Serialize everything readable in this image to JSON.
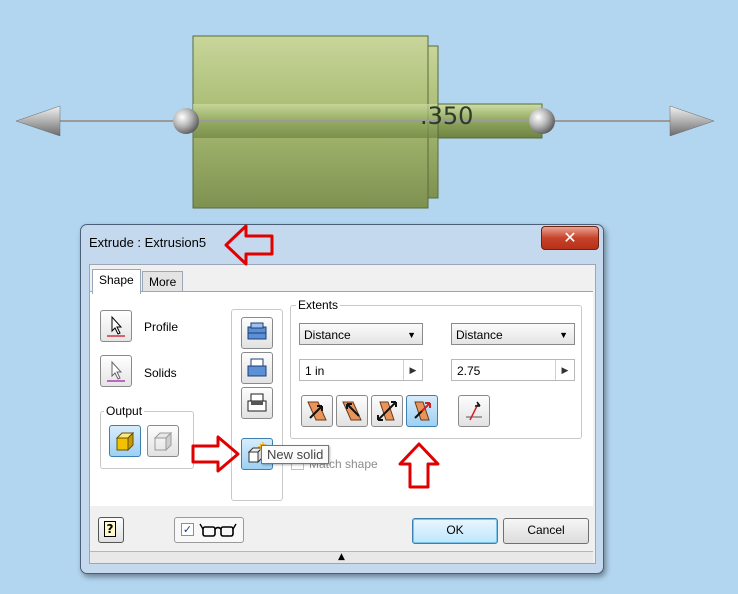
{
  "viewport": {
    "dimension_label": ".350"
  },
  "dialog": {
    "title": "Extrude : Extrusion5",
    "close_glyph": "✕",
    "tabs": [
      {
        "label": "Shape",
        "active": true
      },
      {
        "label": "More",
        "active": false
      }
    ],
    "selection": {
      "profile_label": "Profile",
      "solids_label": "Solids"
    },
    "output": {
      "title": "Output"
    },
    "extents": {
      "title": "Extents",
      "direction1": {
        "type": "Distance",
        "value": "1 in"
      },
      "direction2": {
        "type": "Distance",
        "value": "2.75"
      }
    },
    "match_shape_label": "Match shape",
    "tooltip": "New solid",
    "footer": {
      "help_glyph": "?",
      "preview_checked": "✓",
      "ok_label": "OK",
      "cancel_label": "Cancel",
      "expand_glyph": "▲"
    }
  },
  "colors": {
    "background": "#b3d6f0",
    "part": "#b6c88a",
    "annotation_arrow": "#e00000",
    "accent": "#3c7fb1"
  }
}
